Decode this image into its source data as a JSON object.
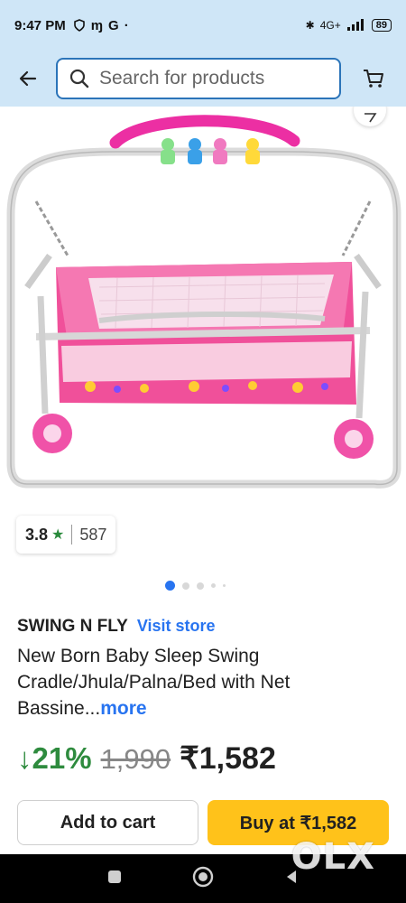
{
  "status_bar": {
    "time": "9:47 PM",
    "icons_left": [
      "shield-icon",
      "m-icon",
      "G"
    ],
    "battery": "89",
    "network": "4G+"
  },
  "header": {
    "search_placeholder": "Search for products",
    "back_icon": "arrow-left-icon",
    "cart_icon": "cart-icon"
  },
  "product": {
    "rating": "3.8",
    "rating_star": "★",
    "rating_count": "587",
    "brand": "SWING N FLY",
    "visit_store": "Visit store",
    "title": "New Born Baby Sleep Swing Cradle/Jhula/Palna/Bed with Net Bassine...",
    "more": "more",
    "discount": "↓21%",
    "mrp": "1,990",
    "price": "₹1,582",
    "image_pages": 5,
    "image_active_page": 1
  },
  "actions": {
    "add_to_cart": "Add to cart",
    "buy_at": "Buy at ₹1,582"
  },
  "watermark": "OLX",
  "colors": {
    "header_bg": "#cfe6f7",
    "accent_blue": "#2874f0",
    "discount_green": "#2e8b3e",
    "buy_yellow": "#ffc21a",
    "cradle_pink": "#f0509a"
  }
}
